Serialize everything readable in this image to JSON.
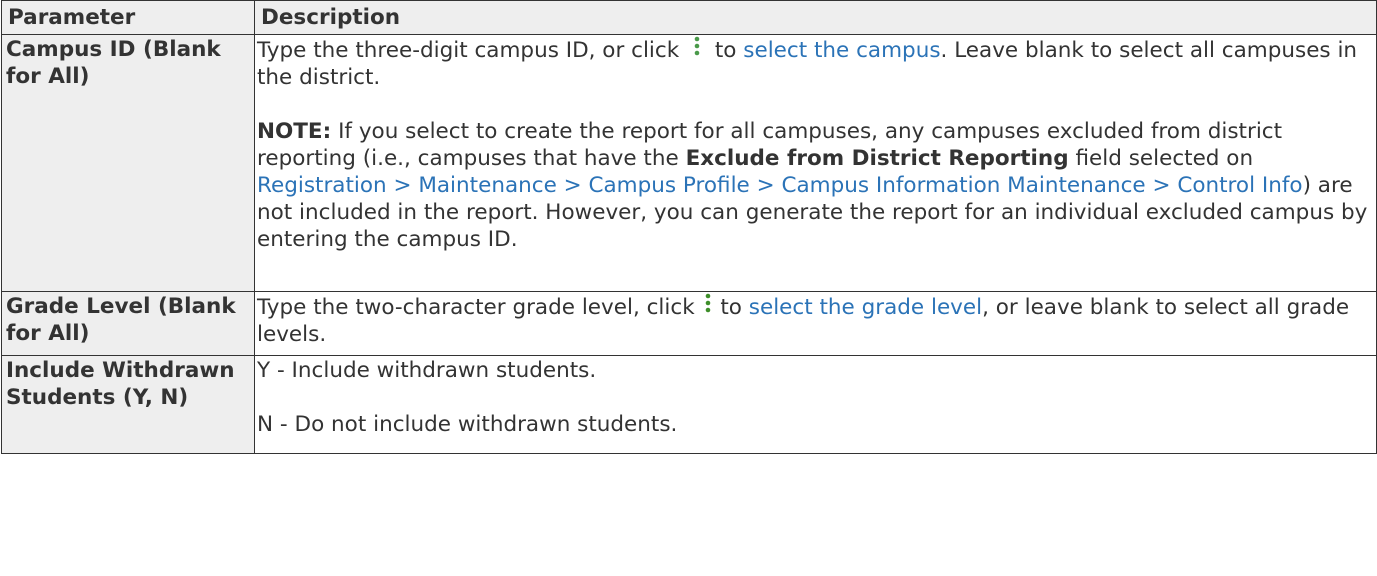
{
  "header": {
    "parameter": "Parameter",
    "description": "Description"
  },
  "rows": [
    {
      "param": "Campus ID (Blank for All)",
      "d1_pre": "Type the three-digit campus ID, or click",
      "d1_link": "select the campus",
      "d1_post": ". Leave blank to select all campuses in the district.",
      "note_label": "NOTE:",
      "note_pre": " If you select to create the report for all campuses, any campuses excluded from district reporting (i.e., campuses that have the ",
      "note_bold": "Exclude from District Reporting",
      "note_mid": " field selected on ",
      "note_link": "Registration > Maintenance > Campus Profile > Campus Information Maintenance > Control Info",
      "note_post": ") are not included in the report. However, you can generate the report for an individual excluded campus by entering the campus ID."
    },
    {
      "param": "Grade Level (Blank for All)",
      "d1_pre": "Type the two-character grade level, click",
      "d1_link": "select the grade level",
      "d1_post": ", or leave blank to select all grade levels."
    },
    {
      "param": "Include Withdrawn Students (Y, N)",
      "line1": "Y - Include withdrawn students.",
      "line2": "N - Do not include withdrawn students."
    }
  ],
  "icons": {
    "lookup": "kebab-lookup-icon",
    "accent": "#3e8e2a"
  },
  "link_color": "#2b73b7"
}
